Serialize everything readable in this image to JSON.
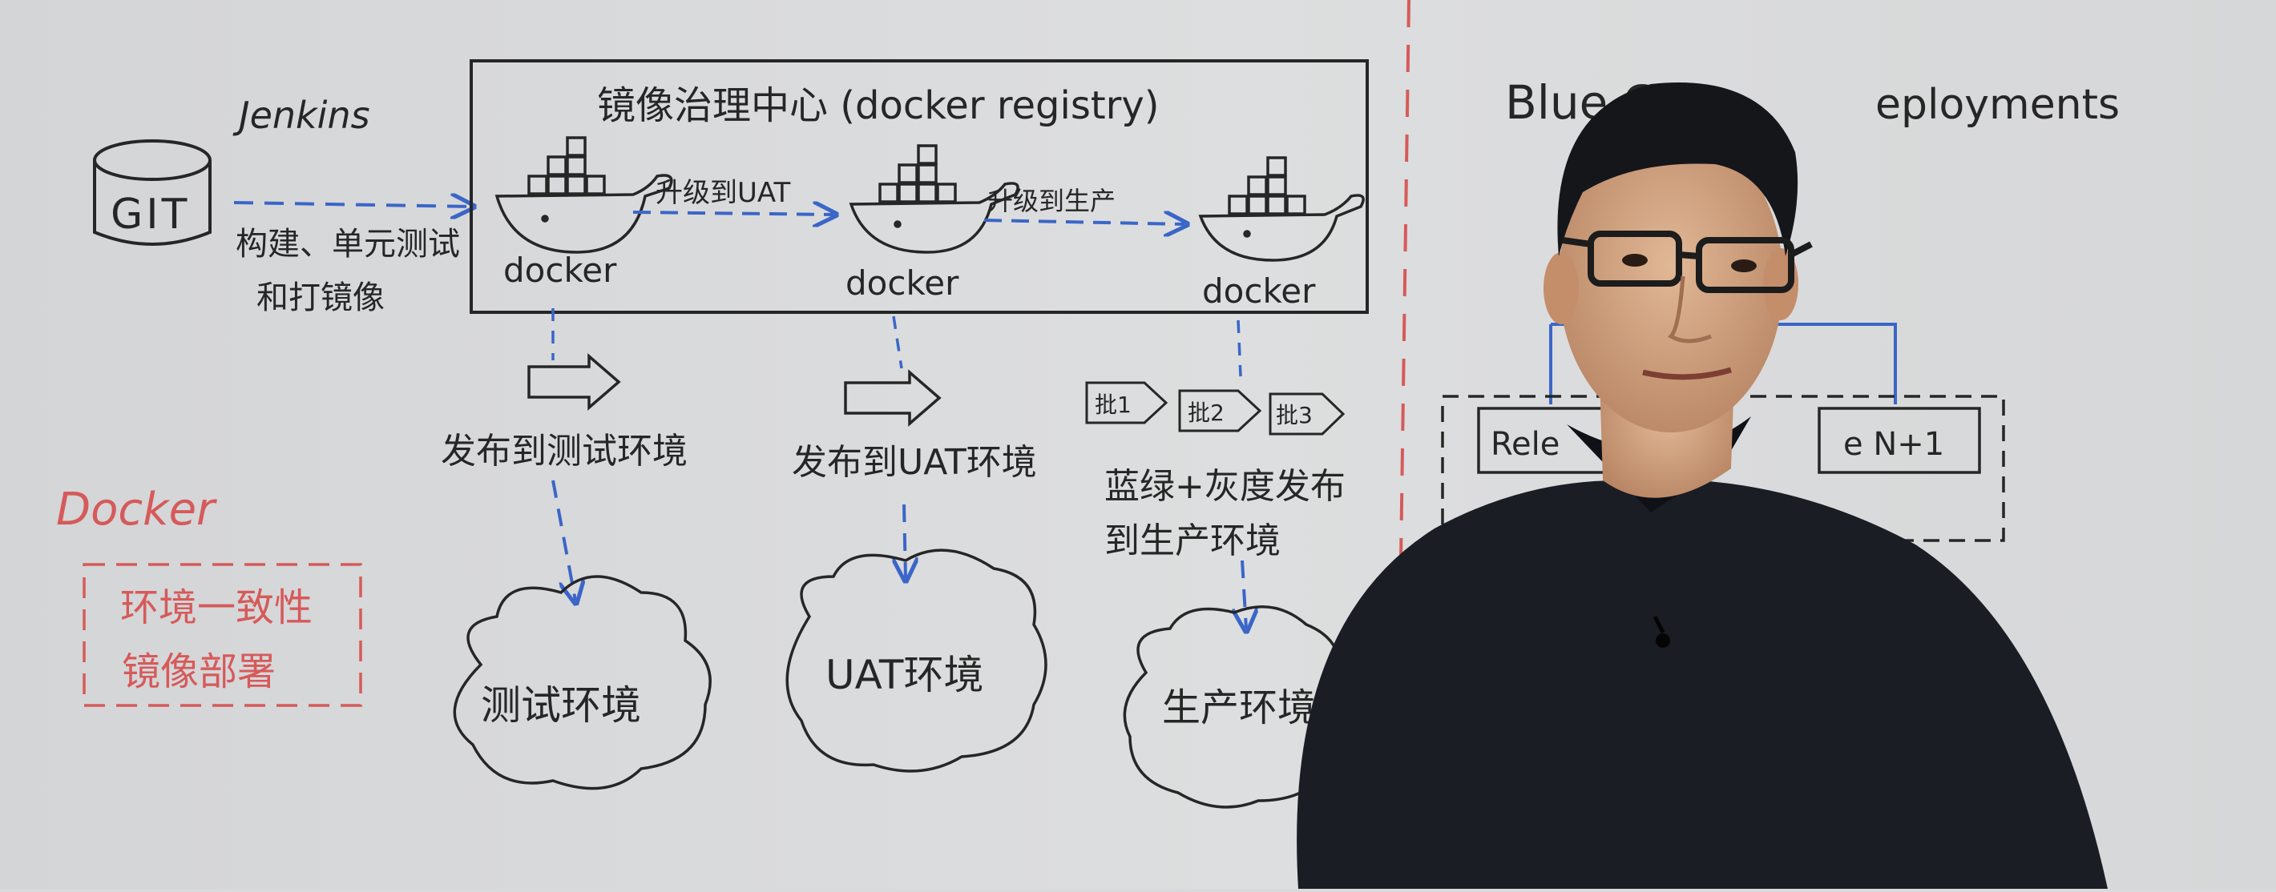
{
  "whiteboard": {
    "jenkins": "Jenkins",
    "git": "GIT",
    "build_note_line1": "构建、单元测试",
    "build_note_line2": "和打镜像",
    "registry_title": "镜像治理中心 (docker registry)",
    "docker_label": "docker",
    "upgrade_uat": "升级到UAT",
    "upgrade_prod": "升级到生产",
    "deploy_test": "发布到测试环境",
    "deploy_uat": "发布到UAT环境",
    "deploy_prod_line1": "蓝绿+灰度发布",
    "deploy_prod_line2": "到生产环境",
    "batches": [
      "批1",
      "批2",
      "批3"
    ],
    "env_test": "测试环境",
    "env_uat": "UAT环境",
    "env_prod": "生产环境",
    "docker_heading": "Docker",
    "docker_note_line1": "环境一致性",
    "docker_note_line2": "镜像部署",
    "right_title_left": "Blue G",
    "right_title_right": "eployments",
    "right_box_left": "Rele",
    "right_box_right": "e N+1"
  },
  "colors": {
    "ink": "#262626",
    "marker_blue": "#3b66c8",
    "marker_red": "#d65a5a",
    "board": "#d9dadb"
  }
}
